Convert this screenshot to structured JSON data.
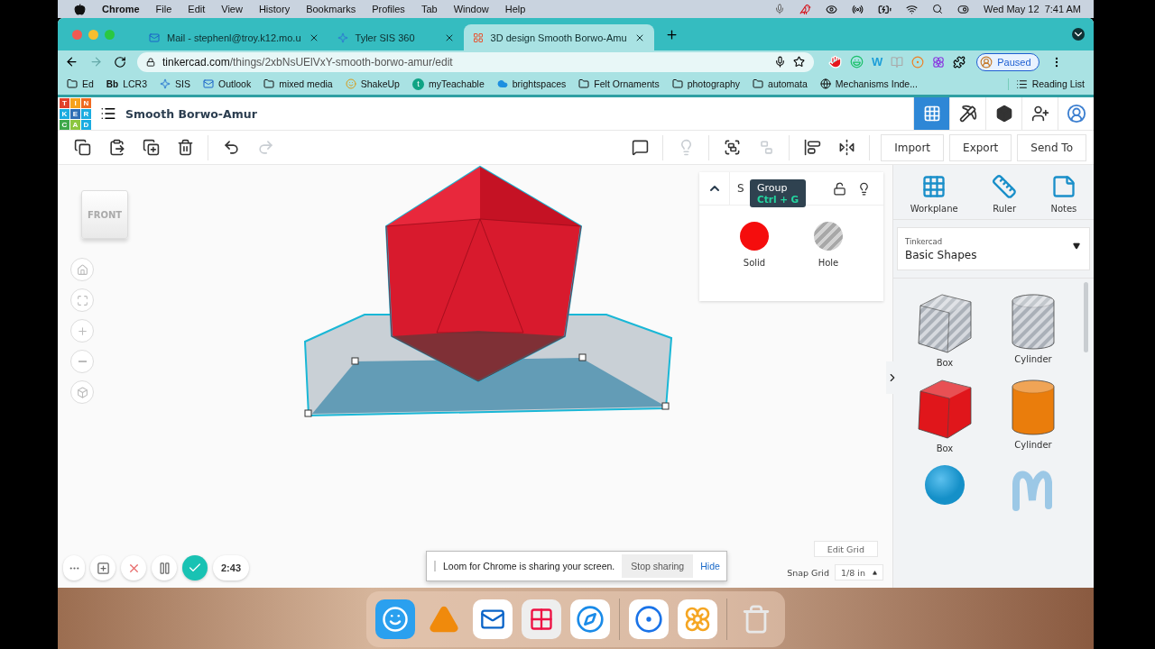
{
  "menu_bar": {
    "app": "Chrome",
    "items": [
      "File",
      "Edit",
      "View",
      "History",
      "Bookmarks",
      "Profiles",
      "Tab",
      "Window",
      "Help"
    ],
    "clock": "Wed May 12  7:41 AM"
  },
  "tabs": [
    {
      "title": "Mail - stephenl@troy.k12.mo.u",
      "selected": false
    },
    {
      "title": "Tyler SIS 360",
      "selected": false
    },
    {
      "title": "3D design Smooth Borwo-Amu",
      "selected": true
    }
  ],
  "address": {
    "domain": "tinkercad.com",
    "path": "/things/2xbNsUElVxY-smooth-borwo-amur/edit"
  },
  "extension_letter": "W",
  "profile": {
    "label": "Paused"
  },
  "bookmarks": [
    {
      "label": "Ed"
    },
    {
      "label": "LCR3",
      "icon_text": "Bb"
    },
    {
      "label": "SIS"
    },
    {
      "label": "Outlook"
    },
    {
      "label": "mixed media"
    },
    {
      "label": "ShakeUp"
    },
    {
      "label": "myTeachable",
      "icon_text": "t"
    },
    {
      "label": "brightspaces"
    },
    {
      "label": "Felt Ornaments"
    },
    {
      "label": "photography"
    },
    {
      "label": "automata"
    },
    {
      "label": "Mechanisms Inde..."
    }
  ],
  "reading_list": "Reading List",
  "logo_letters": [
    "T",
    "I",
    "N",
    "K",
    "E",
    "R",
    "C",
    "A",
    "D"
  ],
  "design": {
    "title": "Smooth Borwo-Amur"
  },
  "edit_tools": [
    {
      "kind": "copy",
      "disabled": false
    },
    {
      "kind": "paste",
      "disabled": false
    },
    {
      "kind": "duplicate",
      "disabled": false
    },
    {
      "kind": "delete",
      "disabled": false
    },
    {
      "kind": "undo",
      "disabled": false
    },
    {
      "kind": "redo",
      "disabled": true
    }
  ],
  "shape_tools": [
    {
      "kind": "notes",
      "disabled": false
    },
    {
      "kind": "light",
      "disabled": true
    },
    {
      "kind": "group",
      "disabled": false
    },
    {
      "kind": "ungroup",
      "disabled": true
    },
    {
      "kind": "align",
      "disabled": false
    },
    {
      "kind": "mirror",
      "disabled": false
    }
  ],
  "actions": [
    "Import",
    "Export",
    "Send To"
  ],
  "tooltip": {
    "title": "Group",
    "shortcut": "Ctrl + G"
  },
  "view_cube": "FRONT",
  "shape_panel": {
    "title": "S",
    "options": [
      {
        "label": "Solid",
        "kind": "solid"
      },
      {
        "label": "Hole",
        "kind": "hole"
      }
    ]
  },
  "tools": [
    {
      "label": "Workplane",
      "kind": "workplane"
    },
    {
      "label": "Ruler",
      "kind": "ruler"
    },
    {
      "label": "Notes",
      "kind": "notes"
    }
  ],
  "library": {
    "source": "Tinkercad",
    "category": "Basic Shapes"
  },
  "shapes": [
    {
      "label": "Box",
      "kind": "box",
      "color": "#c8ccd2"
    },
    {
      "label": "Cylinder",
      "kind": "cylinder",
      "color": "#c8ccd2"
    },
    {
      "label": "Box",
      "kind": "box",
      "color": "#e0161b"
    },
    {
      "label": "Cylinder",
      "kind": "cylinder",
      "color": "#ea7d0c"
    },
    {
      "kind": "sphere",
      "color": "#1590c8"
    },
    {
      "kind": "scribble",
      "color": "#9cc8e6"
    }
  ],
  "recorder": {
    "timer": "2:43"
  },
  "loom_banner": {
    "message": "Loom for Chrome is sharing your screen.",
    "stop": "Stop sharing",
    "hide": "Hide"
  },
  "grid": {
    "edit": "Edit Grid",
    "snap_label": "Snap Grid",
    "snap_value": "1/8 in"
  }
}
